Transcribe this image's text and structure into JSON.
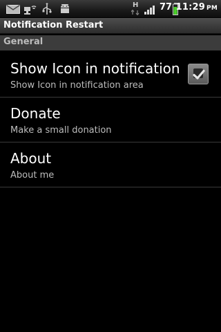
{
  "status_bar": {
    "icons": [
      "mail-icon",
      "network-icon",
      "usb-icon",
      "android-debug-icon",
      "h-signal-icon",
      "signal-bars-icon",
      "battery-icon"
    ],
    "network_type": "H",
    "battery_percent": "77",
    "time": "11:29",
    "ampm": "PM"
  },
  "app": {
    "title": "Notification Restart"
  },
  "category": {
    "label": "General"
  },
  "preferences": [
    {
      "title": "Show Icon in notification area",
      "summary": "Show Icon in notification area",
      "checked": true
    },
    {
      "title": "Donate",
      "summary": "Make a small donation"
    },
    {
      "title": "About",
      "summary": "About me"
    }
  ],
  "colors": {
    "background": "#000000",
    "summary_text": "#bdbdbd",
    "battery_green": "#4cd02c"
  }
}
